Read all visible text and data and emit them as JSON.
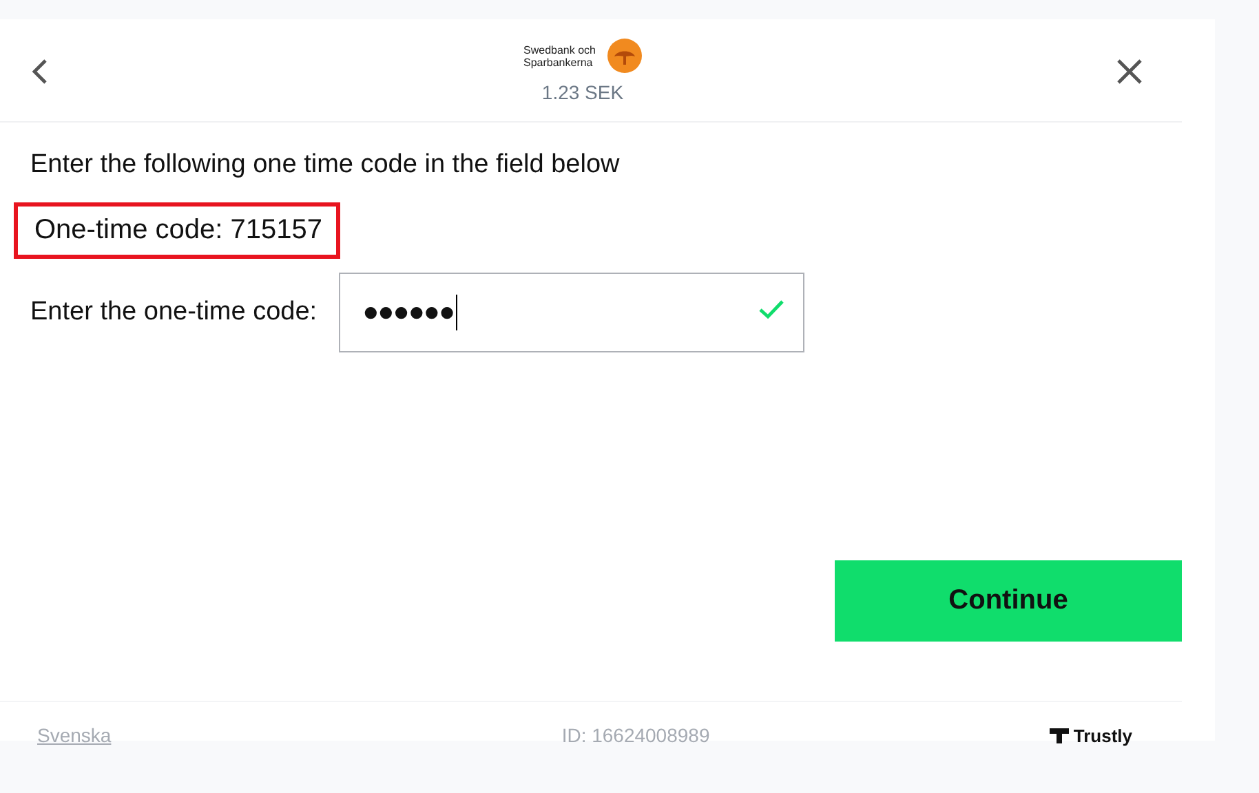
{
  "header": {
    "bank_name": "Swedbank och Sparbankerna",
    "amount": "1.23 SEK"
  },
  "instruction": "Enter the following one time code in the field below",
  "code_notice": {
    "text": "One-time code: 715157",
    "highlighted": true
  },
  "code_field": {
    "label": "Enter the one-time code:",
    "value": "●●●●●●",
    "valid": true
  },
  "buttons": [
    "Continue"
  ],
  "footer": {
    "language": "Svenska",
    "id": "ID: 16624008989",
    "brand": "Trustly"
  }
}
